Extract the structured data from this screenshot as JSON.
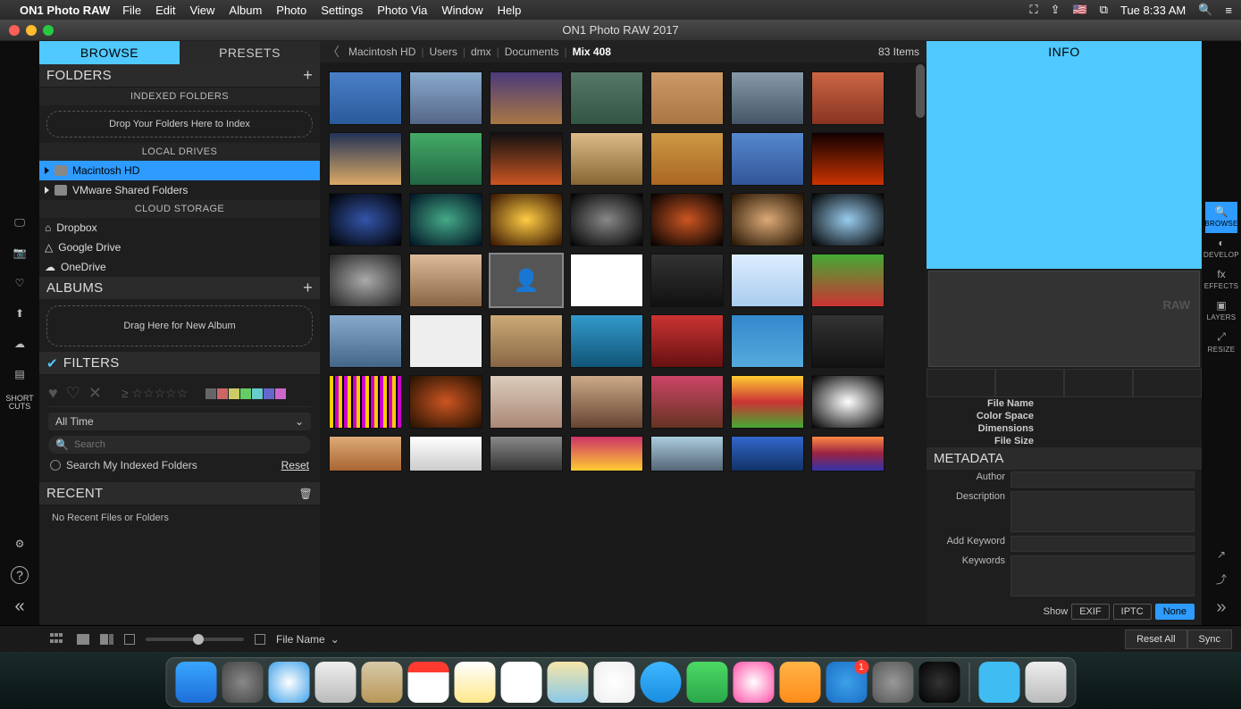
{
  "menubar": {
    "app": "ON1 Photo RAW",
    "items": [
      "File",
      "Edit",
      "View",
      "Album",
      "Photo",
      "Settings",
      "Photo Via",
      "Window",
      "Help"
    ],
    "clock": "Tue 8:33 AM"
  },
  "window": {
    "title": "ON1 Photo RAW 2017"
  },
  "left_tabs": {
    "browse": "BROWSE",
    "presets": "PRESETS"
  },
  "folders": {
    "head": "FOLDERS",
    "indexed_head": "INDEXED FOLDERS",
    "drop_hint": "Drop Your Folders Here to Index",
    "local_head": "LOCAL DRIVES",
    "drive1": "Macintosh HD",
    "drive2": "VMware Shared Folders",
    "cloud_head": "CLOUD STORAGE",
    "cloud": [
      "Dropbox",
      "Google Drive",
      "OneDrive"
    ]
  },
  "albums": {
    "head": "ALBUMS",
    "hint": "Drag Here for New Album"
  },
  "filters": {
    "head": "FILTERS",
    "time": "All Time",
    "search_placeholder": "Search",
    "indexed": "Search My Indexed Folders",
    "reset": "Reset"
  },
  "recent": {
    "head": "RECENT",
    "empty": "No Recent Files or Folders"
  },
  "left_rail": {
    "shortcuts": "SHORT\nCUTS"
  },
  "crumbs": {
    "path": [
      "Macintosh HD",
      "Users",
      "dmx",
      "Documents",
      "Mix 408"
    ],
    "count": "83 Items"
  },
  "right": {
    "info": "INFO",
    "format": "RAW",
    "fields": [
      "File Name",
      "Color Space",
      "Dimensions",
      "File Size"
    ],
    "meta_head": "METADATA",
    "meta_labels": {
      "author": "Author",
      "description": "Description",
      "add_kw": "Add Keyword",
      "keywords": "Keywords"
    },
    "show": "Show",
    "show_opts": [
      "EXIF",
      "IPTC",
      "None"
    ]
  },
  "right_rail": [
    "BROWSE",
    "DEVELOP",
    "EFFECTS",
    "LAYERS",
    "RESIZE"
  ],
  "footer": {
    "sort": "File Name",
    "reset_all": "Reset All",
    "sync": "Sync"
  },
  "dock": {
    "app_store_badge": "1"
  }
}
